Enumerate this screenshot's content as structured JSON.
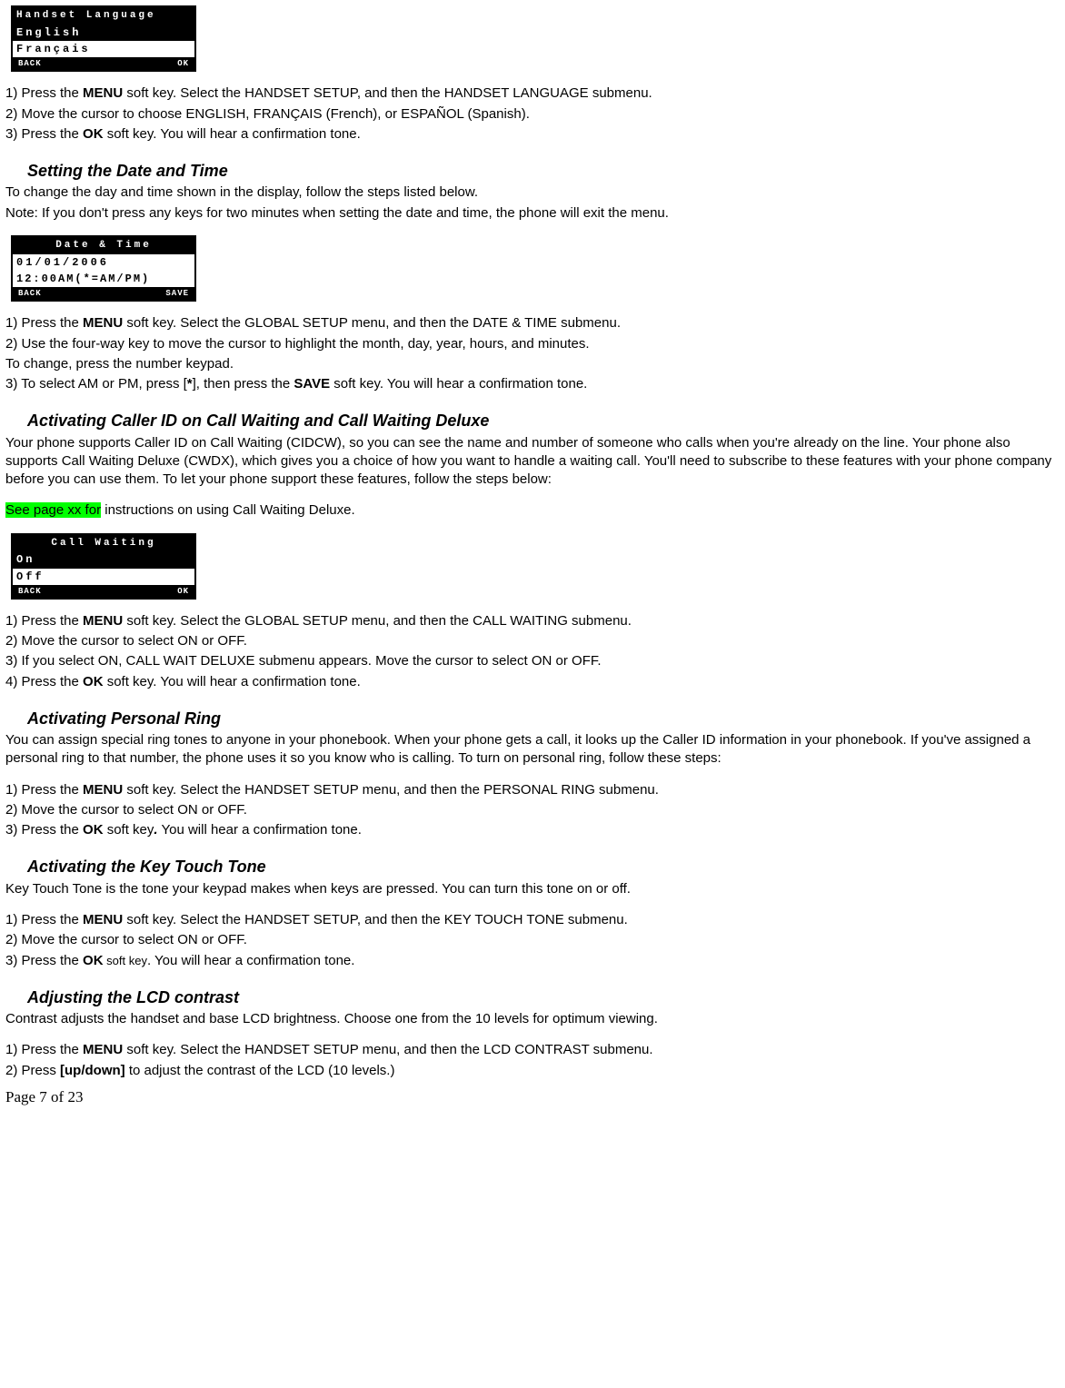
{
  "lcd_lang": {
    "title": "Handset Language",
    "opt1": "English",
    "opt2": "Français",
    "back": "BACK",
    "ok": "OK"
  },
  "sec_lang": {
    "step1_a": "1) Press the ",
    "step1_b": "MENU",
    "step1_c": " soft key. Select the HANDSET SETUP, and then the HANDSET LANGUAGE submenu.",
    "step2": "2) Move the cursor to choose ENGLISH, FRANÇAIS (French), or ESPAÑOL (Spanish).",
    "step3_a": "3) Press the ",
    "step3_b": "OK",
    "step3_c": " soft key. You will hear a confirmation tone."
  },
  "sec_datetime": {
    "heading": "Setting the Date and Time",
    "intro1": "To change the day and time shown in the display, follow the steps listed below.",
    "intro2": "Note: If you don't press any keys for two minutes when setting the date and time, the phone will exit the menu.",
    "lcd": {
      "title": "Date & Time",
      "row1": "01/01/2006",
      "row2": "12:00AM(*=AM/PM)",
      "back": "BACK",
      "save": "SAVE"
    },
    "step1_a": "1) Press the ",
    "step1_b": "MENU",
    "step1_c": " soft key. Select the GLOBAL SETUP menu, and then the DATE & TIME submenu.",
    "step2": "2) Use the four-way key to move the cursor to highlight the month, day, year, hours, and minutes.",
    "step2b": "To change, press the number keypad.",
    "step3_a": "3) To select AM or PM, press [",
    "step3_b": "*",
    "step3_c": "], then press the ",
    "step3_d": "SAVE",
    "step3_e": " soft key. You will hear a confirmation tone."
  },
  "sec_cw": {
    "heading": "Activating Caller ID on Call Waiting and Call Waiting Deluxe",
    "intro": "Your phone supports Caller ID on Call Waiting (CIDCW), so you can see the name and number of someone who calls when you're already on the line. Your phone also supports Call Waiting Deluxe (CWDX), which gives you a choice of how you want to handle a waiting call. You'll need to subscribe to these features with your phone company before you can use them. To let your phone support these features, follow the steps below:",
    "see_hl": "See page xx for",
    "see_rest": " instructions on using Call Waiting Deluxe.",
    "lcd": {
      "title": "Call Waiting",
      "on": "On",
      "off": "Off",
      "back": "BACK",
      "ok": "OK"
    },
    "step1_a": "1) Press the ",
    "step1_b": "MENU",
    "step1_c": " soft key. Select the GLOBAL SETUP menu, and then the CALL WAITING submenu.",
    "step2": "2) Move the cursor to select ON or OFF.",
    "step3": "3) If you select ON, CALL WAIT DELUXE submenu appears. Move the cursor to select ON or OFF.",
    "step4_a": "4) Press the ",
    "step4_b": "OK",
    "step4_c": " soft key. You will hear a confirmation tone."
  },
  "sec_ring": {
    "heading": "Activating Personal Ring",
    "intro": "You can assign special ring tones to anyone in your phonebook. When your phone gets a call, it looks up the Caller ID information in your phonebook. If you've assigned a personal ring to that number, the phone uses it so you know who is calling. To turn on personal ring, follow these steps:",
    "step1_a": "1) Press the ",
    "step1_b": "MENU",
    "step1_c": " soft key. Select the HANDSET SETUP menu, and then the PERSONAL RING submenu.",
    "step2": "2) Move the cursor to select ON or OFF.",
    "step3_a": "3) Press the ",
    "step3_b": "OK",
    "step3_c": " soft key",
    "step3_d": ".",
    "step3_e": " You will hear a confirmation tone."
  },
  "sec_tone": {
    "heading": "Activating the Key Touch Tone",
    "intro": "Key Touch Tone is the tone your keypad makes when keys are pressed. You can turn this tone on or off.",
    "step1_a": "1) Press the ",
    "step1_b": "MENU",
    "step1_c": " soft key. Select the HANDSET SETUP, and then the KEY TOUCH TONE submenu.",
    "step2": "2) Move the cursor to select ON or OFF.",
    "step3_a": "3) Press the ",
    "step3_b": "OK",
    "step3_c": " soft key",
    "step3_d": ". You will hear a confirmation tone."
  },
  "sec_lcdcontrast": {
    "heading": "Adjusting the LCD contrast",
    "intro": "Contrast adjusts the handset and base LCD brightness. Choose one from the 10 levels for optimum viewing.",
    "step1_a": "1) Press the ",
    "step1_b": "MENU",
    "step1_c": " soft key. Select the HANDSET SETUP menu, and then the LCD CONTRAST submenu.",
    "step2_a": "2) Press ",
    "step2_b": "[up/down]",
    "step2_c": " to adjust the contrast of the LCD (10 levels.)"
  },
  "footer": "Page 7 of 23"
}
